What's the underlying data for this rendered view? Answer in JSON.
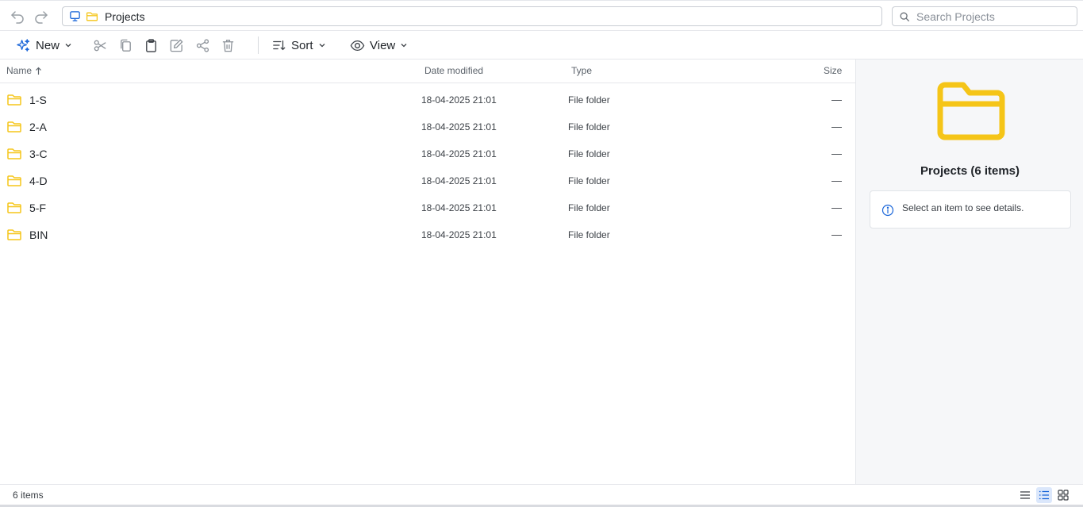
{
  "address": {
    "path": "Projects"
  },
  "search": {
    "placeholder": "Search Projects"
  },
  "toolbar": {
    "new_label": "New",
    "sort_label": "Sort",
    "view_label": "View"
  },
  "columns": {
    "name": "Name",
    "date": "Date modified",
    "type": "Type",
    "size": "Size"
  },
  "rows": [
    {
      "name": "1-S",
      "date": "18-04-2025 21:01",
      "type": "File folder",
      "size": "—"
    },
    {
      "name": "2-A",
      "date": "18-04-2025 21:01",
      "type": "File folder",
      "size": "—"
    },
    {
      "name": "3-C",
      "date": "18-04-2025 21:01",
      "type": "File folder",
      "size": "—"
    },
    {
      "name": "4-D",
      "date": "18-04-2025 21:01",
      "type": "File folder",
      "size": "—"
    },
    {
      "name": "5-F",
      "date": "18-04-2025 21:01",
      "type": "File folder",
      "size": "—"
    },
    {
      "name": "BIN",
      "date": "18-04-2025 21:01",
      "type": "File folder",
      "size": "—"
    }
  ],
  "details": {
    "title": "Projects (6 items)",
    "hint": "Select an item to see details."
  },
  "status": {
    "count": "6 items"
  },
  "colors": {
    "folder": "#f5c518",
    "accent": "#1a66d9",
    "pane": "#f6f7f9"
  },
  "icons": [
    "back-icon",
    "forward-icon",
    "computer-icon",
    "folder-icon",
    "search-icon",
    "sparkle-icon",
    "cut-icon",
    "copy-icon",
    "paste-icon",
    "rename-icon",
    "share-icon",
    "delete-icon",
    "sort-icon",
    "eye-icon",
    "info-icon"
  ]
}
